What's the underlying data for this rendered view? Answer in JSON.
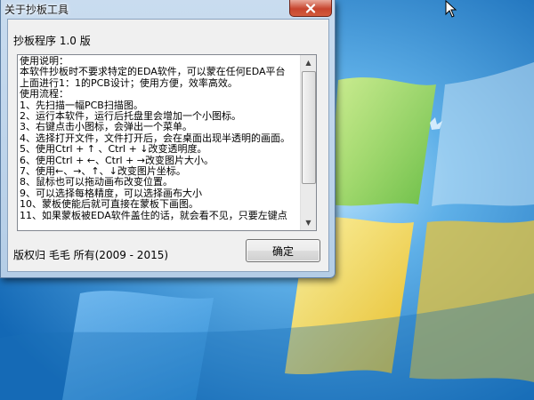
{
  "window": {
    "title": "关于抄板工具",
    "close_label": "✕"
  },
  "dialog": {
    "version_label": "抄板程序 1.0 版",
    "copyright": "版权归 毛毛 所有(2009 - 2015)",
    "ok_label": "确定"
  },
  "memo": {
    "lines": [
      "使用说明：",
      "本软件抄板时不要求特定的EDA软件，可以蒙在任何EDA平台",
      "上面进行1：1的PCB设计；使用方便，效率高效。",
      "使用流程：",
      "1、先扫描一幅PCB扫描图。",
      "2、运行本软件，运行后托盘里会增加一个小图标。",
      "3、右键点击小图标，会弹出一个菜单。",
      "4、选择打开文件，文件打开后，会在桌面出现半透明的画面。",
      "5、使用Ctrl + ↑ 、Ctrl + ↓改变透明度。",
      "6、使用Ctrl + ←、Ctrl + →改变图片大小。",
      "7、使用←、→、↑、↓改变图片坐标。",
      "8、鼠标也可以拖动画布改变位置。",
      "9、可以选择每格精度，可以选择画布大小",
      "10、蒙板使能后就可直接在蒙板下画图。",
      "11、如果蒙板被EDA软件盖住的话，就会看不见，只要左键点"
    ]
  },
  "scrollbar": {
    "up_arrow": "▲",
    "down_arrow": "▼"
  },
  "colors": {
    "desktop_blue": "#1f7fc8",
    "logo_green": "#9bd35a",
    "logo_yellow": "#f5d640"
  }
}
